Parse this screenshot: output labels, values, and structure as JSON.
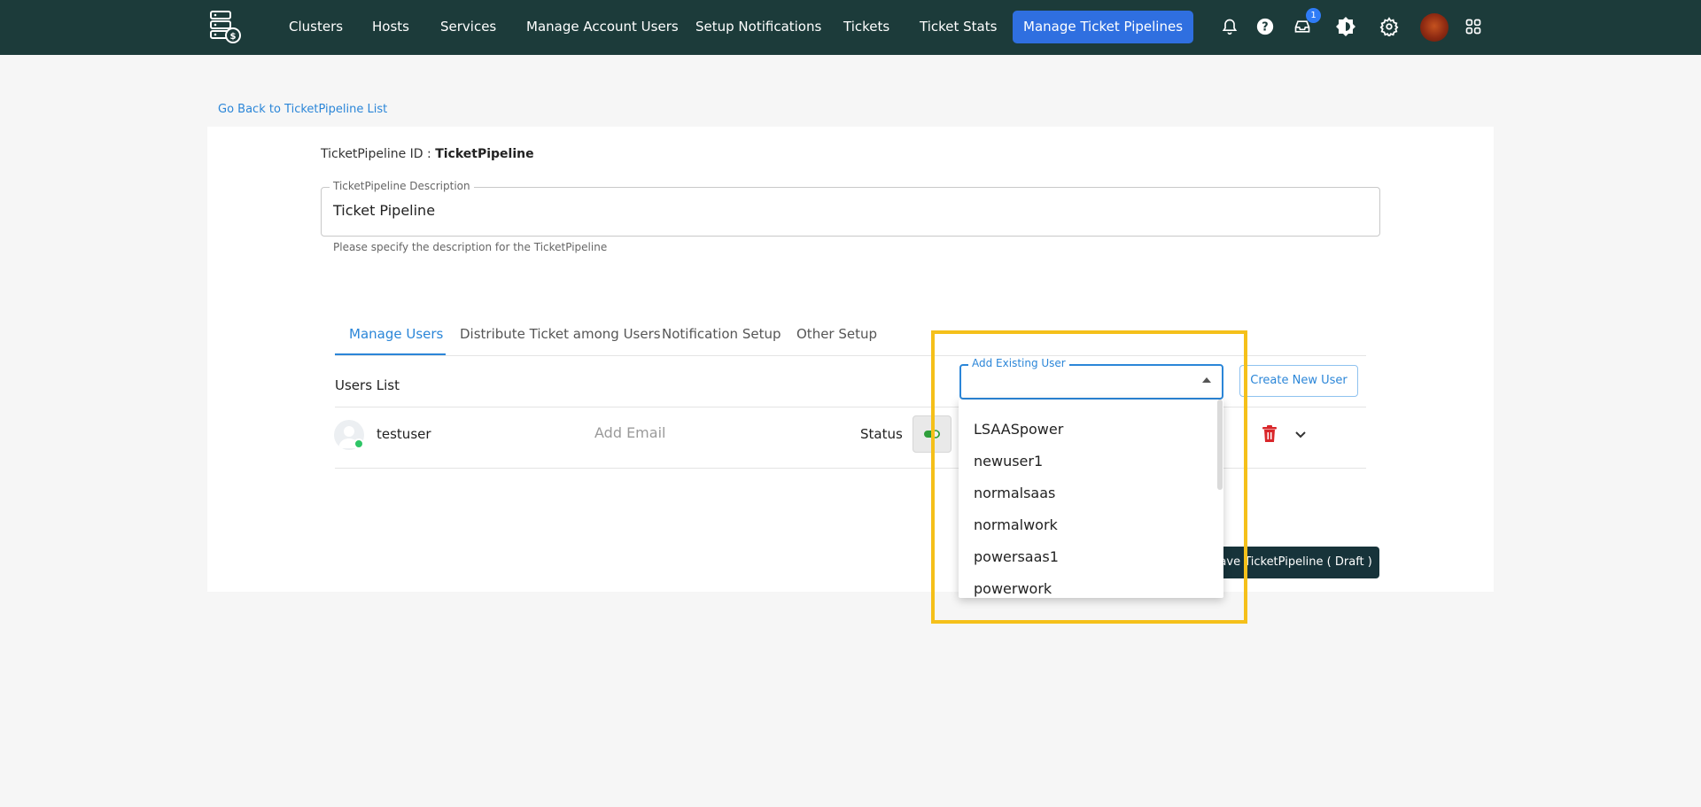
{
  "nav": {
    "items": [
      "Clusters",
      "Hosts",
      "Services",
      "Manage Account Users",
      "Setup Notifications",
      "Tickets",
      "Ticket Stats"
    ],
    "active": "Manage Ticket Pipelines",
    "icons": [
      "bell-icon",
      "help-icon",
      "inbox-icon",
      "theme-icon",
      "gear-icon",
      "avatar",
      "apps-grid-icon"
    ],
    "inbox_badge": "1"
  },
  "page": {
    "back_link": "Go Back to TicketPipeline List",
    "id_label": "TicketPipeline ID : ",
    "id_value": "TicketPipeline",
    "description": {
      "legend": "TicketPipeline Description",
      "value": "Ticket Pipeline",
      "help": "Please specify the description for the TicketPipeline"
    },
    "tabs": [
      "Manage Users",
      "Distribute Ticket among Users",
      "Notification Setup",
      "Other Setup"
    ],
    "active_tab": "Manage Users",
    "users_list_label": "Users List",
    "add_existing": {
      "legend": "Add Existing User",
      "value": "",
      "options": [
        "LSAASpower",
        "newuser1",
        "normalsaas",
        "normalwork",
        "powersaas1",
        "powerwork"
      ]
    },
    "create_user_button": "Create New User",
    "users": [
      {
        "name": "testuser",
        "email_placeholder": "Add Email",
        "status_label": "Status"
      }
    ],
    "save_button": "Save TicketPipeline ( Draft )"
  },
  "colors": {
    "topbar": "#1c3b3a",
    "accent": "#2b86d8",
    "active_nav": "#2f6fe0",
    "highlight": "#f5c01a",
    "save_button": "#17333a"
  }
}
